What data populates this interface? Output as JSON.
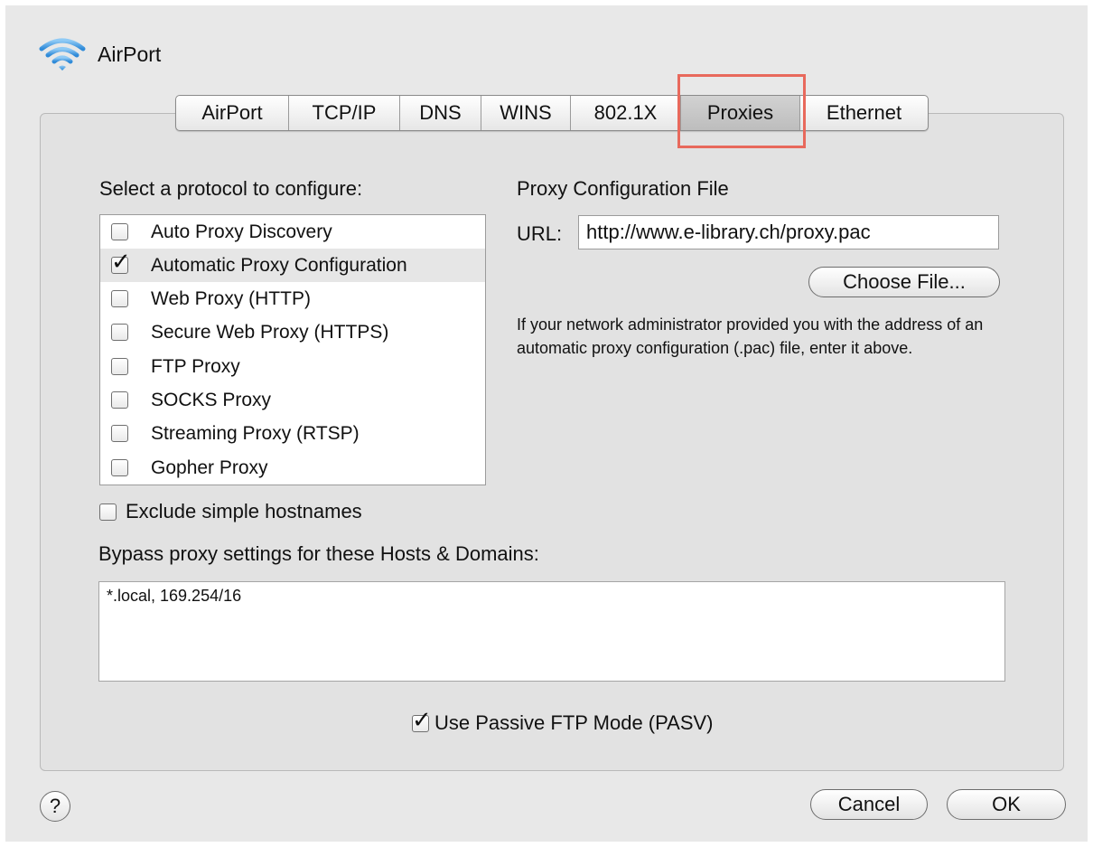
{
  "header": {
    "title": "AirPort"
  },
  "tabs": [
    {
      "label": "AirPort"
    },
    {
      "label": "TCP/IP"
    },
    {
      "label": "DNS"
    },
    {
      "label": "WINS"
    },
    {
      "label": "802.1X"
    },
    {
      "label": "Proxies",
      "active": true
    },
    {
      "label": "Ethernet"
    }
  ],
  "protocols": {
    "heading": "Select a protocol to configure:",
    "items": [
      {
        "label": "Auto Proxy Discovery",
        "checked": false
      },
      {
        "label": "Automatic Proxy Configuration",
        "checked": true,
        "selected": true
      },
      {
        "label": "Web Proxy (HTTP)",
        "checked": false
      },
      {
        "label": "Secure Web Proxy (HTTPS)",
        "checked": false
      },
      {
        "label": "FTP Proxy",
        "checked": false
      },
      {
        "label": "SOCKS Proxy",
        "checked": false
      },
      {
        "label": "Streaming Proxy (RTSP)",
        "checked": false
      },
      {
        "label": "Gopher Proxy",
        "checked": false
      }
    ]
  },
  "config": {
    "heading": "Proxy Configuration File",
    "url_label": "URL:",
    "url_value": "http://www.e-library.ch/proxy.pac",
    "choose_button": "Choose File...",
    "help_text": "If your network administrator provided you with the address of an automatic proxy configuration (.pac) file, enter it above."
  },
  "exclude": {
    "label": "Exclude simple hostnames",
    "checked": false
  },
  "bypass": {
    "label": "Bypass proxy settings for these Hosts & Domains:",
    "value": "*.local, 169.254/16"
  },
  "passive_ftp": {
    "label": "Use Passive FTP Mode (PASV)",
    "checked": true
  },
  "footer": {
    "help_label": "?",
    "cancel_label": "Cancel",
    "ok_label": "OK"
  },
  "colors": {
    "highlight": "#e8695c",
    "wifi_icon": "#5aa7e6"
  },
  "icons": {
    "wifi": "wifi-icon",
    "check": "checkmark-icon"
  }
}
